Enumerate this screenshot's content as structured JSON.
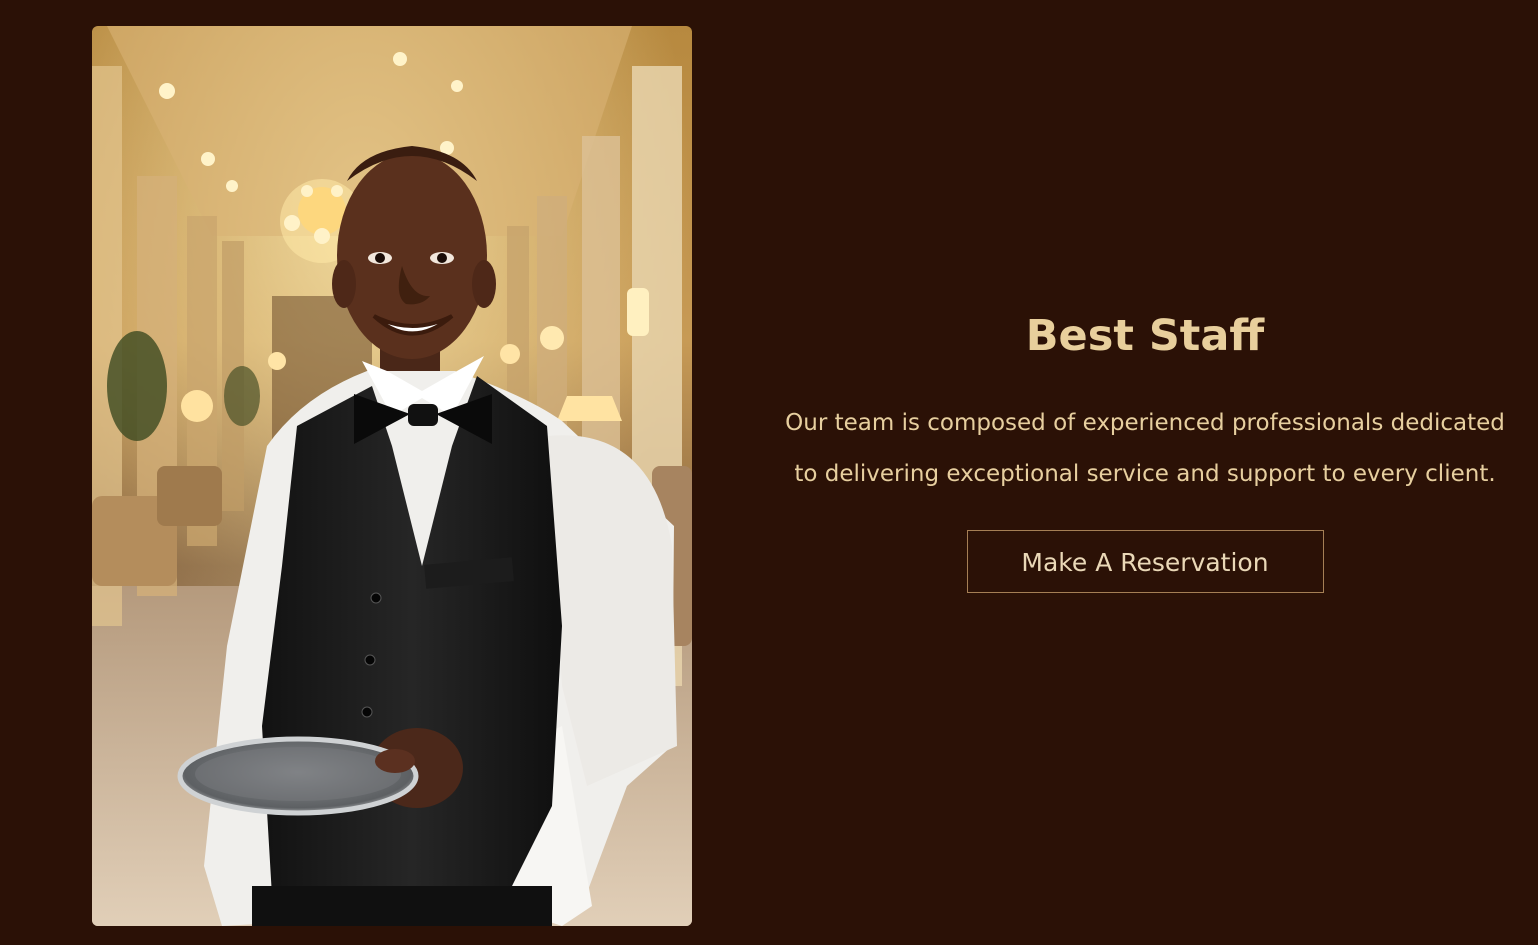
{
  "section": {
    "title": "Best Staff",
    "description": "Our team is composed of experienced professionals dedicated to delivering exceptional service and support to every client.",
    "button_label": "Make A Reservation"
  },
  "colors": {
    "background": "#2b1106",
    "heading": "#e8cf9c",
    "text": "#e7cf9f",
    "button_border": "#a57f55"
  }
}
